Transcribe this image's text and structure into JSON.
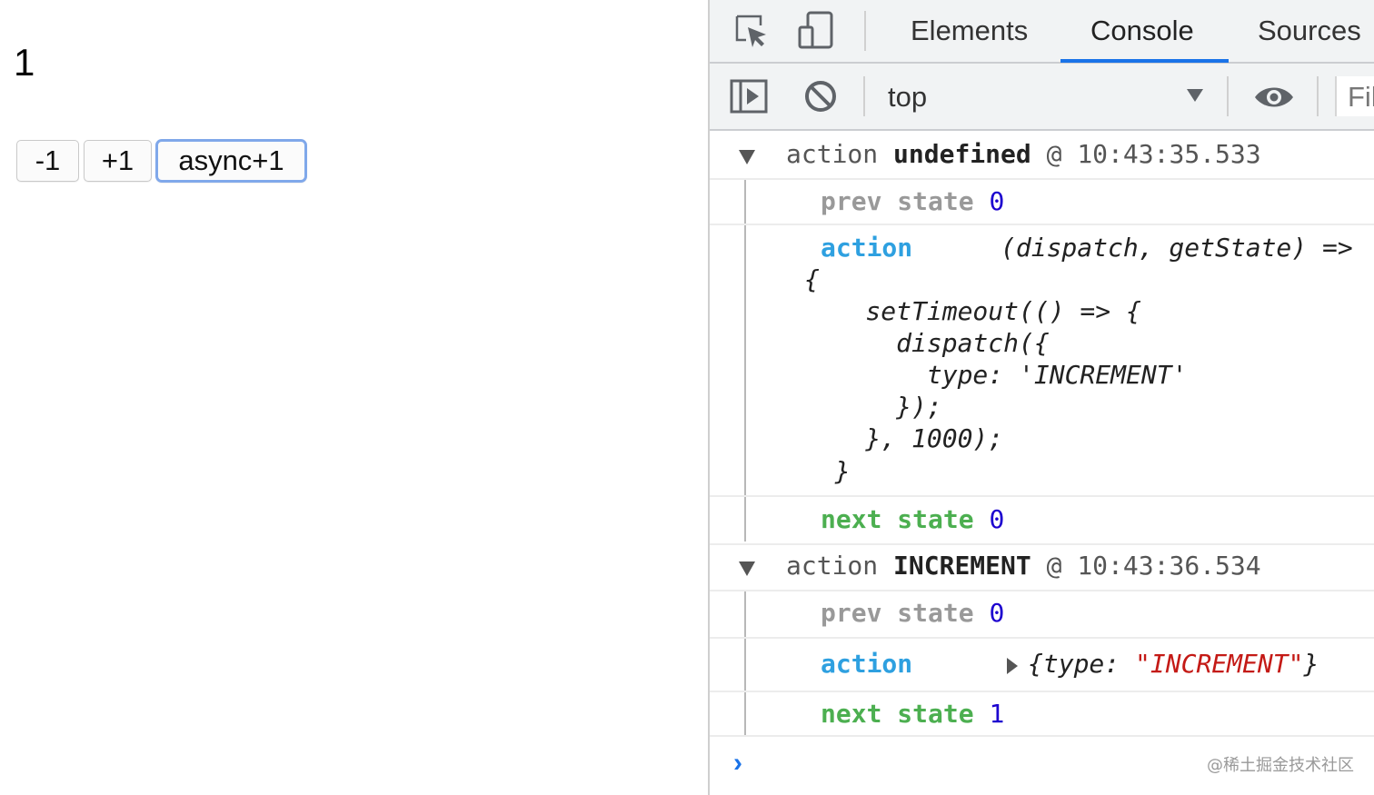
{
  "app": {
    "counter": "1",
    "buttons": {
      "decrement": "-1",
      "increment": "+1",
      "async": "async+1"
    }
  },
  "devtools": {
    "tabs": [
      "Elements",
      "Console",
      "Sources"
    ],
    "active_tab": "Console",
    "context": "top",
    "filter_placeholder": "Fil",
    "accent_color": "#1a73e8",
    "logs": [
      {
        "label": "action",
        "type": "undefined",
        "at": "@",
        "time": "10:43:35.533",
        "prev_label": "prev state",
        "prev_value": "0",
        "action_label": "action",
        "action_lines": [
          "(dispatch, getState) =>",
          "{",
          "    setTimeout(() => {",
          "      dispatch({",
          "        type: 'INCREMENT'",
          "      });",
          "    }, 1000);",
          "  }"
        ],
        "next_label": "next state",
        "next_value": "0"
      },
      {
        "label": "action",
        "type": "INCREMENT",
        "at": "@",
        "time": "10:43:36.534",
        "prev_label": "prev state",
        "prev_value": "0",
        "action_label": "action",
        "action_obj_open": "{type: ",
        "action_obj_str": "\"INCREMENT\"",
        "action_obj_close": "}",
        "next_label": "next state",
        "next_value": "1"
      }
    ],
    "prompt": "›",
    "watermark": "@稀土掘金技术社区"
  }
}
